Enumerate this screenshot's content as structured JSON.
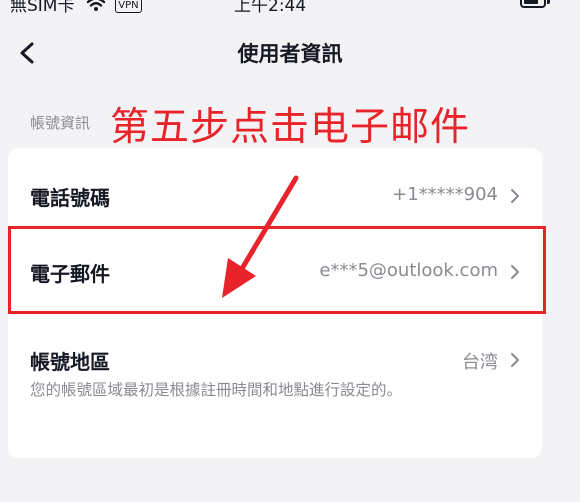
{
  "status_bar": {
    "carrier": "無SIM卡",
    "vpn": "VPN",
    "time": "上午2:44"
  },
  "nav": {
    "title": "使用者資訊"
  },
  "section": {
    "label": "帳號資訊"
  },
  "annotation": {
    "text": "第五步点击电子邮件",
    "color": "#e8232a"
  },
  "rows": [
    {
      "label": "電話號碼",
      "value": "+1*****904"
    },
    {
      "label": "電子郵件",
      "value": "e***5@outlook.com"
    },
    {
      "label": "帳號地區",
      "value": "台湾"
    }
  ],
  "region_description": "您的帳號區域最初是根據註冊時間和地點進行設定的。",
  "icons": {
    "back": "chevron-left-icon",
    "row_arrow": "chevron-right-icon",
    "wifi": "wifi-icon",
    "battery": "battery-icon",
    "annotation_arrow": "arrow-icon"
  }
}
